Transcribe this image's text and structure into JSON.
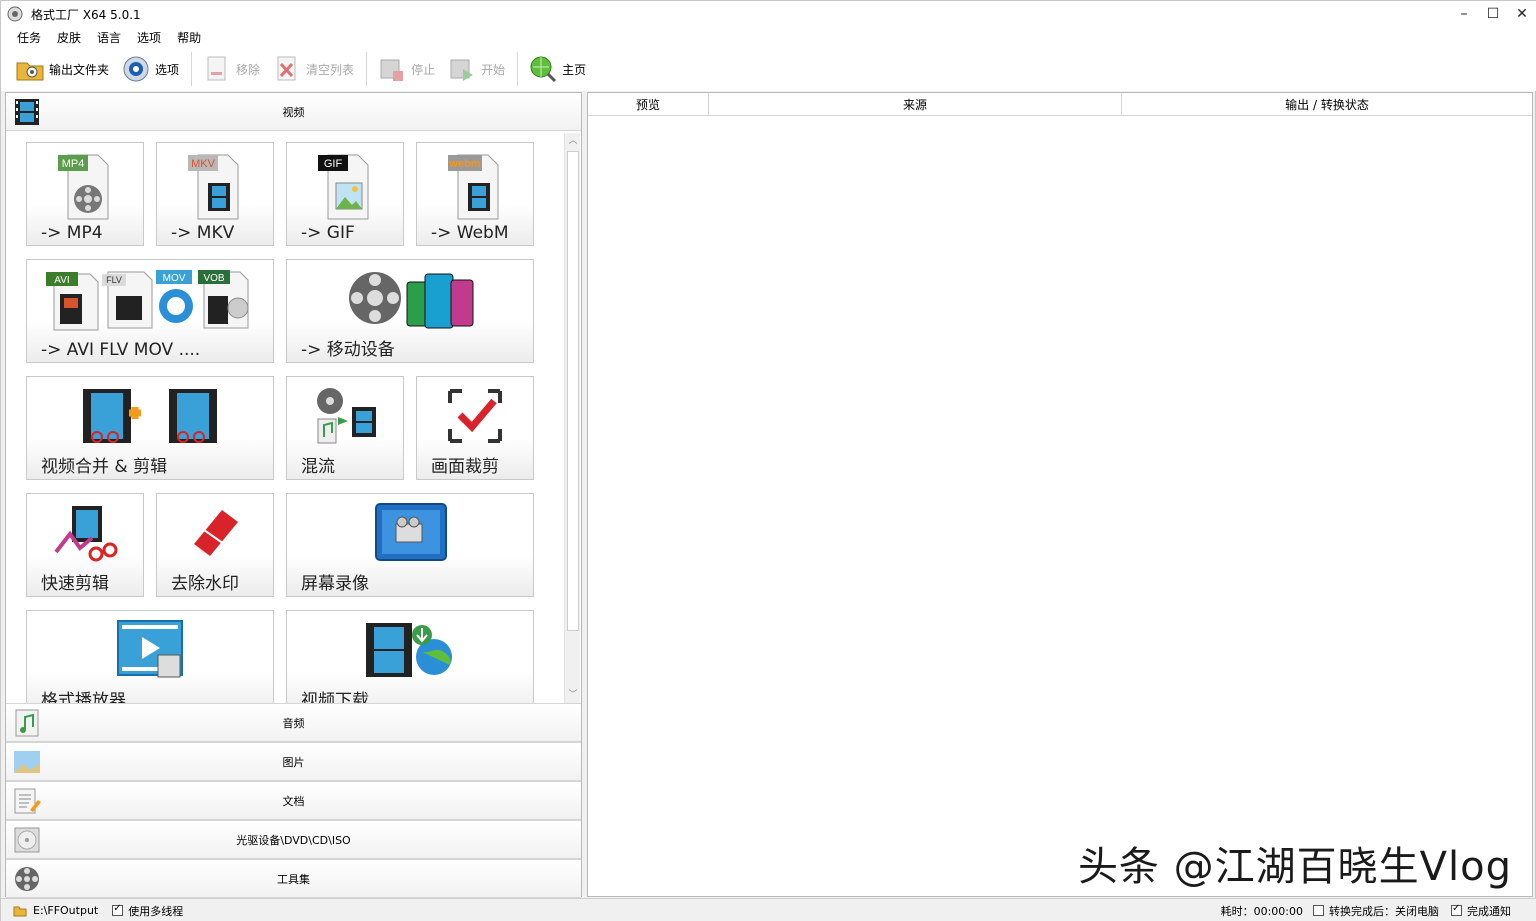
{
  "window": {
    "title": "格式工厂 X64 5.0.1",
    "minimize": "–",
    "maximize": "☐",
    "close": "✕"
  },
  "menu": [
    "任务",
    "皮肤",
    "语言",
    "选项",
    "帮助"
  ],
  "toolbar": {
    "output_folder": "输出文件夹",
    "options": "选项",
    "remove": "移除",
    "clear_list": "清空列表",
    "stop": "停止",
    "start": "开始",
    "home": "主页"
  },
  "left": {
    "video_category": "视频",
    "tiles": [
      "-> MP4",
      "-> MKV",
      "-> GIF",
      "-> WebM",
      "-> AVI FLV MOV ....",
      "-> 移动设备",
      "视频合并 & 剪辑",
      "混流",
      "画面裁剪",
      "快速剪辑",
      "去除水印",
      "屏幕录像",
      "格式播放器",
      "视频下载"
    ],
    "tile_icon_text": {
      "mp4": "MP4",
      "mkv": "MKV",
      "gif": "GIF",
      "webm": "webm",
      "avi": "AVI",
      "flv": "FLV",
      "mov": "MOV",
      "vob": "VOB"
    },
    "categories": [
      "音频",
      "图片",
      "文档",
      "光驱设备\\DVD\\CD\\ISO",
      "工具集"
    ],
    "scroll_up": "︿",
    "scroll_down": "﹀"
  },
  "right": {
    "columns": [
      "预览",
      "来源",
      "输出 / 转换状态"
    ],
    "watermark": "头条 @江湖百晓生Vlog"
  },
  "status": {
    "output_path": "E:\\FFOutput",
    "multithread": "使用多线程",
    "elapsed": "耗时：00:00:00",
    "after_done": "转换完成后：关闭电脑",
    "notify": "完成通知"
  }
}
